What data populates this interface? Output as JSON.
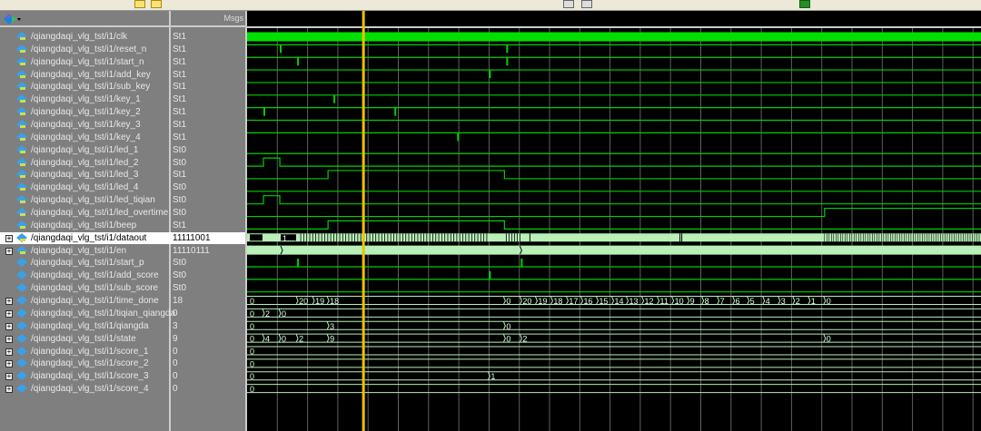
{
  "header": {
    "msgs_label": "Msgs"
  },
  "colors": {
    "wave": "#00d000",
    "bus": "#b8f0b8",
    "cursor": "#f0c000",
    "grid": "#606060"
  },
  "signals": [
    {
      "name": "/qiangdaqi_vlg_tst/i1/clk",
      "value": "St1",
      "kind": "clock"
    },
    {
      "name": "/qiangdaqi_vlg_tst/i1/reset_n",
      "value": "St1",
      "kind": "bit",
      "init": 1,
      "pulses": [
        35,
        284
      ]
    },
    {
      "name": "/qiangdaqi_vlg_tst/i1/start_n",
      "value": "St1",
      "kind": "bit",
      "init": 1,
      "pulses": [
        54,
        284
      ]
    },
    {
      "name": "/qiangdaqi_vlg_tst/i1/add_key",
      "value": "St1",
      "kind": "bit",
      "init": 1,
      "pulses": [
        265
      ]
    },
    {
      "name": "/qiangdaqi_vlg_tst/i1/sub_key",
      "value": "St1",
      "kind": "bit",
      "init": 1,
      "pulses": []
    },
    {
      "name": "/qiangdaqi_vlg_tst/i1/key_1",
      "value": "St1",
      "kind": "bit",
      "init": 1,
      "pulses": [
        94
      ]
    },
    {
      "name": "/qiangdaqi_vlg_tst/i1/key_2",
      "value": "St1",
      "kind": "bit",
      "init": 1,
      "pulses": [
        17,
        161
      ]
    },
    {
      "name": "/qiangdaqi_vlg_tst/i1/key_3",
      "value": "St1",
      "kind": "bit",
      "init": 1,
      "pulses": []
    },
    {
      "name": "/qiangdaqi_vlg_tst/i1/key_4",
      "value": "St1",
      "kind": "bit",
      "init": 1,
      "pulses": [
        230
      ]
    },
    {
      "name": "/qiangdaqi_vlg_tst/i1/led_1",
      "value": "St0",
      "kind": "bit",
      "init": 0,
      "edges": []
    },
    {
      "name": "/qiangdaqi_vlg_tst/i1/led_2",
      "value": "St0",
      "kind": "bit",
      "init": 0,
      "edges": [
        17,
        35
      ]
    },
    {
      "name": "/qiangdaqi_vlg_tst/i1/led_3",
      "value": "St1",
      "kind": "bit",
      "init": 0,
      "edges": [
        88,
        282
      ]
    },
    {
      "name": "/qiangdaqi_vlg_tst/i1/led_4",
      "value": "St0",
      "kind": "bit",
      "init": 0,
      "edges": []
    },
    {
      "name": "/qiangdaqi_vlg_tst/i1/led_tiqian",
      "value": "St0",
      "kind": "bit",
      "init": 0,
      "edges": [
        17,
        35
      ]
    },
    {
      "name": "/qiangdaqi_vlg_tst/i1/led_overtime",
      "value": "St0",
      "kind": "bit",
      "init": 0,
      "edges": [
        634
      ]
    },
    {
      "name": "/qiangdaqi_vlg_tst/i1/beep",
      "value": "St1",
      "kind": "bit",
      "init": 0,
      "edges": [
        88,
        282
      ]
    },
    {
      "name": "/qiangdaqi_vlg_tst/i1/dataout",
      "value": "11111001",
      "kind": "busy",
      "selected": true,
      "label": "1..."
    },
    {
      "name": "/qiangdaqi_vlg_tst/i1/en",
      "value": "11110111",
      "kind": "bus",
      "filled": true,
      "changes": [
        [
          0,
          ""
        ],
        [
          37,
          ""
        ],
        [
          300,
          ""
        ]
      ]
    },
    {
      "name": "/qiangdaqi_vlg_tst/i1/start_p",
      "value": "St0",
      "kind": "bit",
      "init": 0,
      "pulsesHigh": [
        54,
        300
      ]
    },
    {
      "name": "/qiangdaqi_vlg_tst/i1/add_score",
      "value": "St0",
      "kind": "bit",
      "init": 0,
      "pulsesHigh": [
        265
      ]
    },
    {
      "name": "/qiangdaqi_vlg_tst/i1/sub_score",
      "value": "St0",
      "kind": "bit",
      "init": 0,
      "pulsesHigh": []
    },
    {
      "name": "/qiangdaqi_vlg_tst/i1/time_done",
      "value": "18",
      "kind": "bus",
      "changes": [
        [
          0,
          "0"
        ],
        [
          54,
          "20"
        ],
        [
          72,
          "19"
        ],
        [
          88,
          "18"
        ],
        [
          282,
          "0"
        ],
        [
          300,
          "20"
        ],
        [
          317,
          "19"
        ],
        [
          334,
          "18"
        ],
        [
          351,
          "17"
        ],
        [
          367,
          "16"
        ],
        [
          384,
          "15"
        ],
        [
          401,
          "14"
        ],
        [
          417,
          "13"
        ],
        [
          434,
          "12"
        ],
        [
          451,
          "11"
        ],
        [
          467,
          "10"
        ],
        [
          484,
          "9"
        ],
        [
          500,
          "8"
        ],
        [
          517,
          "7"
        ],
        [
          534,
          "6"
        ],
        [
          550,
          "5"
        ],
        [
          567,
          "4"
        ],
        [
          584,
          "3"
        ],
        [
          600,
          "2"
        ],
        [
          617,
          "1"
        ],
        [
          634,
          "0"
        ]
      ]
    },
    {
      "name": "/qiangdaqi_vlg_tst/i1/tiqian_qiangda",
      "value": "0",
      "kind": "bus",
      "changes": [
        [
          0,
          "0"
        ],
        [
          17,
          "2"
        ],
        [
          35,
          "0"
        ]
      ]
    },
    {
      "name": "/qiangdaqi_vlg_tst/i1/qiangda",
      "value": "3",
      "kind": "bus",
      "changes": [
        [
          0,
          "0"
        ],
        [
          88,
          "3"
        ],
        [
          282,
          "0"
        ]
      ]
    },
    {
      "name": "/qiangdaqi_vlg_tst/i1/state",
      "value": "9",
      "kind": "bus",
      "changes": [
        [
          0,
          "0"
        ],
        [
          17,
          "4"
        ],
        [
          35,
          "0"
        ],
        [
          54,
          "2"
        ],
        [
          88,
          "9"
        ],
        [
          282,
          "0"
        ],
        [
          300,
          "2"
        ],
        [
          634,
          "0"
        ]
      ]
    },
    {
      "name": "/qiangdaqi_vlg_tst/i1/score_1",
      "value": "0",
      "kind": "bus",
      "changes": [
        [
          0,
          "0"
        ]
      ]
    },
    {
      "name": "/qiangdaqi_vlg_tst/i1/score_2",
      "value": "0",
      "kind": "bus",
      "changes": [
        [
          0,
          "0"
        ]
      ]
    },
    {
      "name": "/qiangdaqi_vlg_tst/i1/score_3",
      "value": "0",
      "kind": "bus",
      "changes": [
        [
          0,
          "0"
        ],
        [
          265,
          "1"
        ]
      ]
    },
    {
      "name": "/qiangdaqi_vlg_tst/i1/score_4",
      "value": "0",
      "kind": "bus",
      "changes": [
        [
          0,
          "0"
        ]
      ]
    }
  ],
  "cursor_time": 127,
  "window_time": 807
}
